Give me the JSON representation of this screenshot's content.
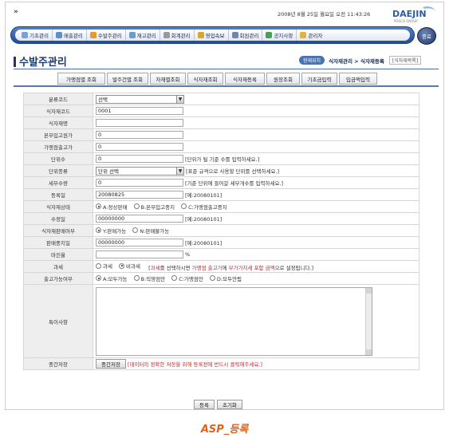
{
  "header": {
    "arrows": "»",
    "datetime": "2008년 8월 25일 월요일 오전 11:43:26",
    "logo_text": "DAEJIN",
    "logo_sub": "POSCO GROUP"
  },
  "menu": {
    "items": [
      {
        "label": "기초관리",
        "color": "#7aa0d6"
      },
      {
        "label": "매출관리",
        "color": "#5f8fc7"
      },
      {
        "label": "수발주관리",
        "color": "#e59b2c"
      },
      {
        "label": "재고관리",
        "color": "#6a9bd1"
      },
      {
        "label": "회계관리",
        "color": "#9a9a9a"
      },
      {
        "label": "영업속보",
        "color": "#d4a92b"
      },
      {
        "label": "회원관리",
        "color": "#6f86b0"
      },
      {
        "label": "공지사항",
        "color": "#4d9e55"
      },
      {
        "label": "관리자",
        "color": "#e0b33a"
      }
    ],
    "logout": "종료"
  },
  "page": {
    "title": "수발주관리",
    "crumb_here": "현재위치",
    "crumb_path": "식자재관리 > 식자재등록",
    "crumb_code": "[식자재목록]"
  },
  "subtabs": [
    "가맹점별 조회",
    "발주건별 조회",
    "자재별조회",
    "식자재조회",
    "식자재등록",
    "원장조회",
    "기초금입력",
    "입금액입력"
  ],
  "form": {
    "category_label": "분류코드",
    "category_value": "선택",
    "code_label": "식자재코드",
    "code_value": "0001",
    "name_label": "식자재명",
    "name_value": "",
    "head_price_label": "본부입고원가",
    "head_price_value": "0",
    "store_price_label": "가맹점출고가",
    "store_price_value": "0",
    "unit_qty_label": "단위수",
    "unit_qty_value": "0",
    "unit_qty_hint": "[단위가 될 기준 수를 입력하세요.]",
    "unit_type_label": "단위종류",
    "unit_type_value": "단위 선택",
    "unit_type_hint": "[표준 규격으로 사용할 단위를 선택하세요.]",
    "detail_qty_label": "세부수량",
    "detail_qty_value": "0",
    "detail_qty_hint": "[기준 단위에 들어갈 세부개수를 입력하세요.]",
    "reg_date_label": "등록일",
    "reg_date_value": "20080825",
    "reg_date_hint": "[예:20080101]",
    "status_label": "식자재상태",
    "status_options": [
      "A:정상판매",
      "B:본부입고중지",
      "C:가맹점출고중지"
    ],
    "mod_date_label": "수정일",
    "mod_date_value": "00000000",
    "mod_date_hint": "[예:20080101]",
    "sale_label": "식자재판매여부",
    "sale_options": [
      "Y:판매가능",
      "N:판매불가능"
    ],
    "stop_date_label": "판매중지일",
    "stop_date_value": "00000000",
    "stop_date_hint": "[예:20080101]",
    "margin_label": "마진율",
    "margin_value": "",
    "margin_unit": "%",
    "tax_label": "과세",
    "tax_options": [
      "과세",
      "비과세"
    ],
    "tax_hint_1": "[",
    "tax_hint_2": "과세",
    "tax_hint_3": "를 선택하시면 ",
    "tax_hint_4": "가맹점 출고가",
    "tax_hint_5": "에 ",
    "tax_hint_6": "부가가치세 포함 금액",
    "tax_hint_7": "으로 설정됩니다.]",
    "ship_label": "출고가능여부",
    "ship_options": [
      "A:모두가능",
      "B:직영점만",
      "C:가맹점만",
      "D:모두안됨"
    ],
    "note_label": "특이사항",
    "temp_label": "중간저장",
    "temp_button": "중간저장",
    "temp_hint": "[데이터의 정확한 저장을 위해 등록전에 반드시 클릭해주세요.]"
  },
  "buttons": {
    "register": "등록",
    "reset": "초기화"
  },
  "caption": "ASP_등록"
}
